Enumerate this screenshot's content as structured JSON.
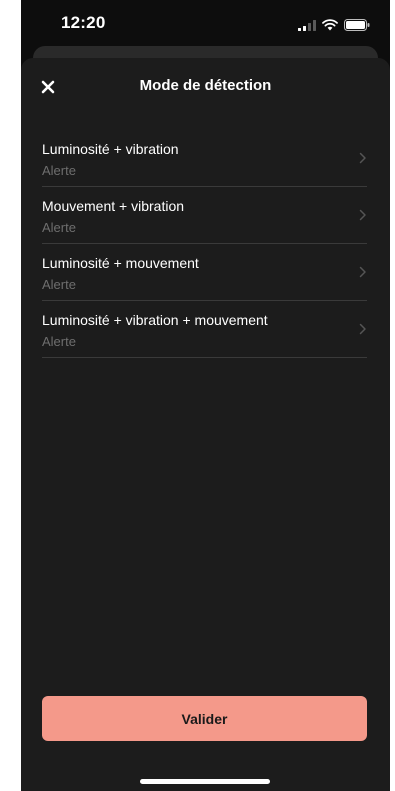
{
  "status_bar": {
    "time": "12:20"
  },
  "sheet": {
    "title": "Mode de détection",
    "close_icon": "close-icon"
  },
  "items": [
    {
      "label": "Luminosité + vibration",
      "subtitle": "Alerte"
    },
    {
      "label": "Mouvement + vibration",
      "subtitle": "Alerte"
    },
    {
      "label": "Luminosité + mouvement",
      "subtitle": "Alerte"
    },
    {
      "label": "Luminosité + vibration + mouvement",
      "subtitle": "Alerte"
    }
  ],
  "footer": {
    "validate_label": "Valider"
  },
  "colors": {
    "background": "#0d0d0d",
    "sheet": "#1c1c1c",
    "accent": "#f4998a",
    "subtitle": "#6e6e6e"
  }
}
